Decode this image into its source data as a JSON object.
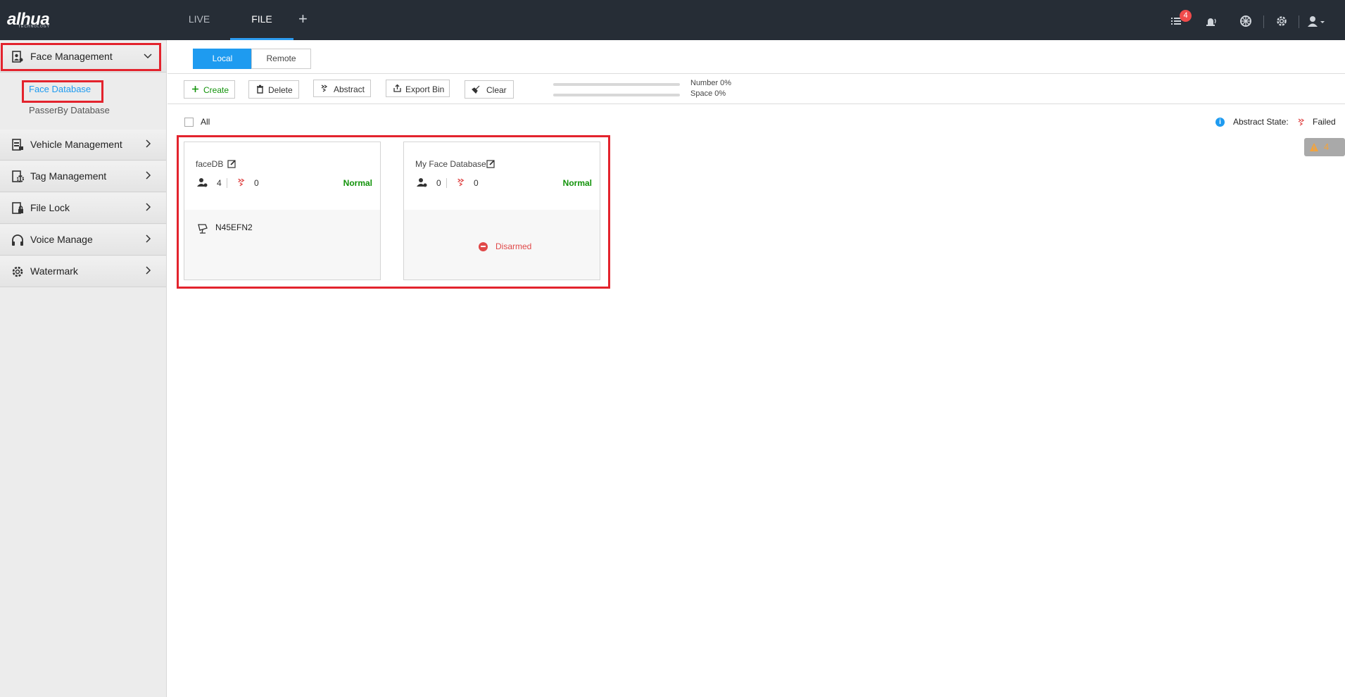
{
  "header": {
    "logo": "alhua",
    "logo_sub": "TECHNOLOGY",
    "tabs": [
      {
        "label": "LIVE"
      },
      {
        "label": "FILE"
      }
    ],
    "add_tab": "+",
    "notification_count": "4",
    "icons": [
      "task-list-icon",
      "alarm-icon",
      "backup-icon",
      "settings-icon",
      "user-icon"
    ]
  },
  "sidebar": {
    "items": [
      {
        "label": "Face Management",
        "icon": "face-management-icon",
        "expanded": true
      },
      {
        "label": "Vehicle Management",
        "icon": "vehicle-management-icon"
      },
      {
        "label": "Tag Management",
        "icon": "tag-management-icon"
      },
      {
        "label": "File Lock",
        "icon": "file-lock-icon"
      },
      {
        "label": "Voice Manage",
        "icon": "headphones-icon"
      },
      {
        "label": "Watermark",
        "icon": "gear-icon"
      }
    ],
    "sub_items": [
      {
        "label": "Face Database",
        "active": true
      },
      {
        "label": "PasserBy Database",
        "active": false
      }
    ]
  },
  "segmented": {
    "local": "Local",
    "remote": "Remote",
    "selected": "Local"
  },
  "toolbar": {
    "create": "Create",
    "delete": "Delete",
    "abstract": "Abstract",
    "export_bin": "Export Bin",
    "clear": "Clear"
  },
  "usage": {
    "number": "Number 0%",
    "space": "Space 0%",
    "number_pct": 0,
    "space_pct": 0
  },
  "list_header": {
    "all": "All",
    "abstract_state": "Abstract State:",
    "failed": "Failed"
  },
  "warning_count": "4",
  "cards": [
    {
      "name": "faceDB",
      "faces": "4",
      "failed": "0",
      "status": "Normal",
      "bottom": "N45EFN2"
    },
    {
      "name": "My Face Database",
      "faces": "0",
      "failed": "0",
      "status": "Normal",
      "bottom": "Disarmed"
    }
  ],
  "colors": {
    "accent": "#1e9bf0",
    "highlight": "#e3232d",
    "normal": "#12930a",
    "error": "#e04848",
    "topbar": "#262d36"
  }
}
